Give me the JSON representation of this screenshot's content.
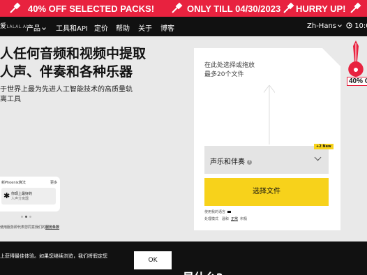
{
  "promo_bar": {
    "text1": "40% OFF SELECTED PACKS!",
    "text2": "ONLY TILL 04/30/2023",
    "text3": "HURRY UP!",
    "color": "#e8223f"
  },
  "nav": {
    "logo_text": "LALAL.AI",
    "logo_prefix": "爱",
    "items": [
      "产品",
      "工具和API",
      "定价",
      "帮助",
      "关于",
      "博客"
    ],
    "language": "Zh-Hans",
    "time": "10:0"
  },
  "hero": {
    "title_line1": "人任何音频和视频中提取",
    "title_line2": "人声、伴奏和各种乐器",
    "subtitle_line1": "于世界上最为先进人工智能技术的高质量轨",
    "subtitle_line2": "离工具"
  },
  "preview": {
    "header": "新Phoenix算法",
    "more": "更多",
    "card_title": "你现上最好的",
    "card_sub": "人声分离器",
    "note_prefix": "使用服务即代表您同意我们的",
    "note_link": "服务条款"
  },
  "upload": {
    "line1": "在此处选择或拖放",
    "line2": "最多20个文件",
    "select_value": "声乐和伴奏",
    "badge": "+2 New",
    "choose_button": "选择文件",
    "small1": "使用我的语言",
    "small2_a": "处理模式",
    "small2_b": "温和",
    "small2_c": "正常",
    "small2_d": "积极",
    "accent": "#f7d21b"
  },
  "side_promo": {
    "percent": "40% O"
  },
  "cookie": {
    "message": "上获得最佳体验。如果您继续浏览，我们将假定您",
    "ok": "OK",
    "peek": "是什么?"
  }
}
